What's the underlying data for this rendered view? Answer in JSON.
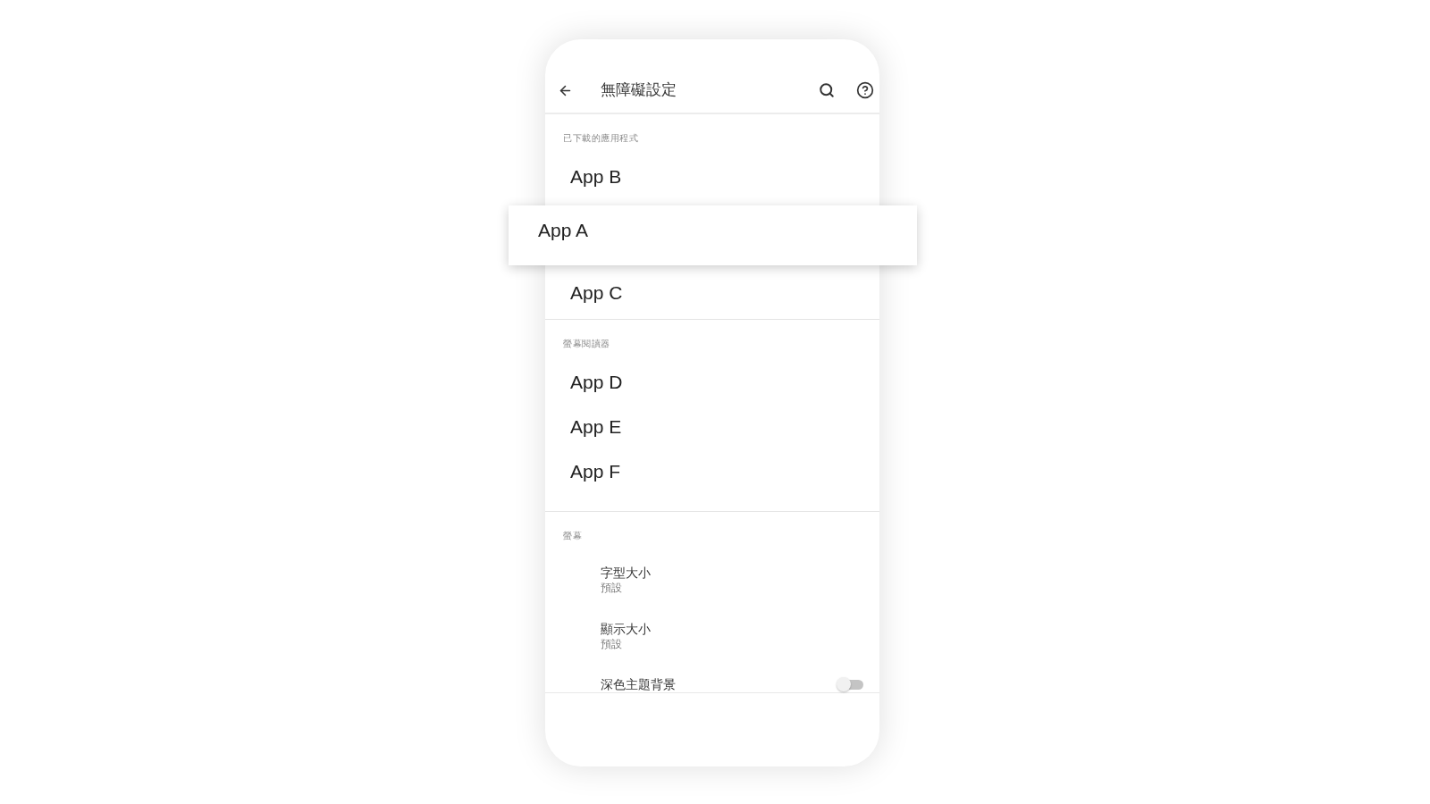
{
  "app_bar": {
    "title": "無障礙設定"
  },
  "sections": [
    {
      "header": "已下載的應用程式",
      "items": [
        {
          "kind": "app",
          "title": "App B",
          "dragging": false
        },
        {
          "kind": "app",
          "title": "App A",
          "dragging": true
        },
        {
          "kind": "app",
          "title": "App C",
          "dragging": false
        }
      ]
    },
    {
      "header": "螢幕閱讀器",
      "items": [
        {
          "kind": "app",
          "title": "App D",
          "dragging": false
        },
        {
          "kind": "app",
          "title": "App E",
          "dragging": false
        },
        {
          "kind": "app",
          "title": "App F",
          "dragging": false
        }
      ]
    },
    {
      "header": "螢幕",
      "items": [
        {
          "kind": "setting",
          "title": "字型大小",
          "summary": "預設"
        },
        {
          "kind": "setting",
          "title": "顯示大小",
          "summary": "預設"
        },
        {
          "kind": "switch",
          "title": "深色主題背景",
          "on": false
        }
      ]
    }
  ]
}
